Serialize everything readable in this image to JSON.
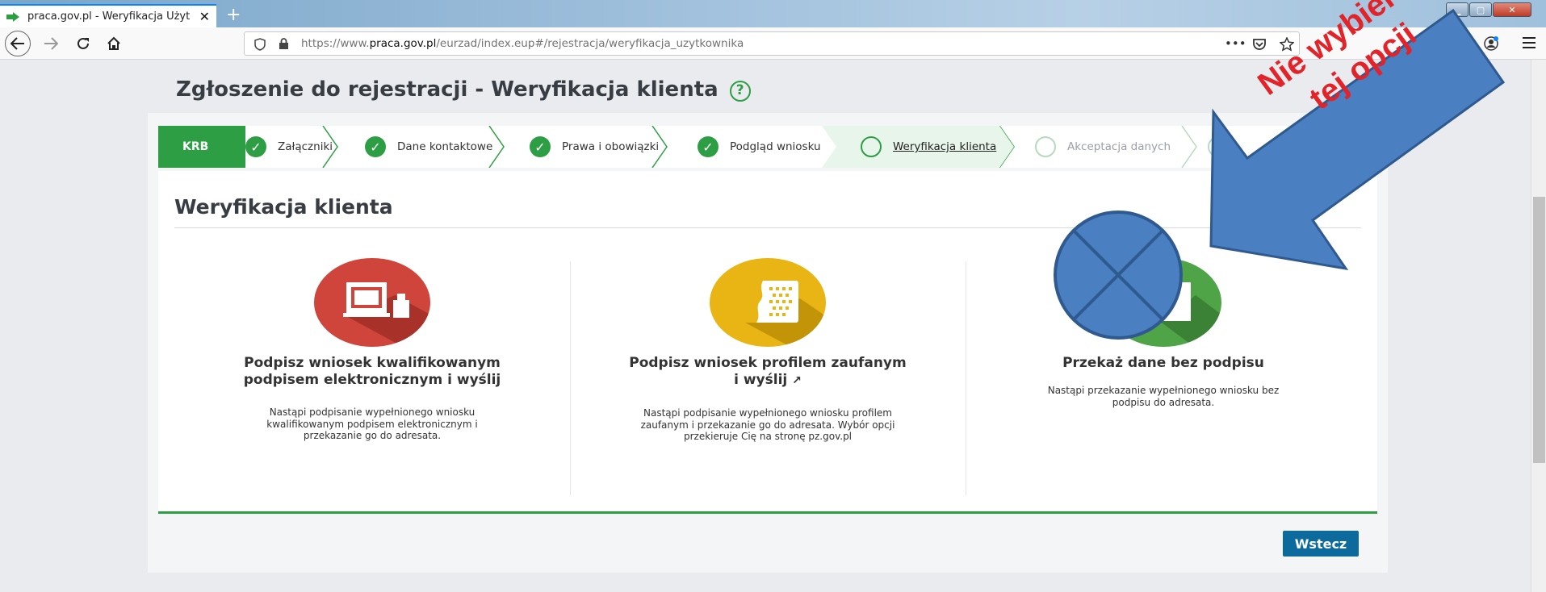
{
  "browser": {
    "tab_title": "praca.gov.pl - Weryfikacja Użyt",
    "tab_close": "✕",
    "new_tab": "+",
    "url_prefix": "https://www.",
    "url_domain": "praca.gov.pl",
    "url_path": "/eurzad/index.eup#/rejestracja/weryfikacja_uzytkownika",
    "url_more": "•••"
  },
  "page": {
    "title": "Zgłoszenie do rejestracji - Weryfikacja klienta",
    "help": "?"
  },
  "steps": {
    "first": "KRB",
    "items": [
      {
        "label": "Załączniki",
        "state": "done"
      },
      {
        "label": "Dane kontaktowe",
        "state": "done"
      },
      {
        "label": "Prawa i obowiązki",
        "state": "done"
      },
      {
        "label": "Podgląd wniosku",
        "state": "done"
      },
      {
        "label": "Weryfikacja klienta",
        "state": "active"
      },
      {
        "label": "Akceptacja danych",
        "state": "pending"
      }
    ]
  },
  "section": {
    "title": "Weryfikacja klienta"
  },
  "options": [
    {
      "title_line1": "Podpisz wniosek kwalifikowanym",
      "title_line2": "podpisem elektronicznym i wyślij",
      "desc_line1": "Nastąpi podpisanie wypełnionego wniosku",
      "desc_line2": "kwalifikowanym podpisem elektronicznym i",
      "desc_line3": "przekazanie go do adresata.",
      "color": "#d0453b"
    },
    {
      "title_line1": "Podpisz wniosek profilem zaufanym",
      "title_line2": "i wyślij",
      "desc_line1": "Nastąpi podpisanie wypełnionego wniosku profilem",
      "desc_line2": "zaufanym i przekazanie go do adresata. Wybór opcji",
      "desc_line3": "przekieruje Cię na stronę pz.gov.pl",
      "color": "#e9b514"
    },
    {
      "title_line1": "Przekaż dane bez podpisu",
      "desc_line1": "Nastąpi przekazanie wypełnionego wniosku bez",
      "desc_line2": "podpisu do adresata.",
      "color": "#4ea447"
    }
  ],
  "footer": {
    "back_button": "Wstecz"
  },
  "annotation": {
    "line1": "Nie wybieraj",
    "line2": "tej opcji",
    "arrow_color": "#4a7fc1",
    "text_color": "#e2242a"
  }
}
